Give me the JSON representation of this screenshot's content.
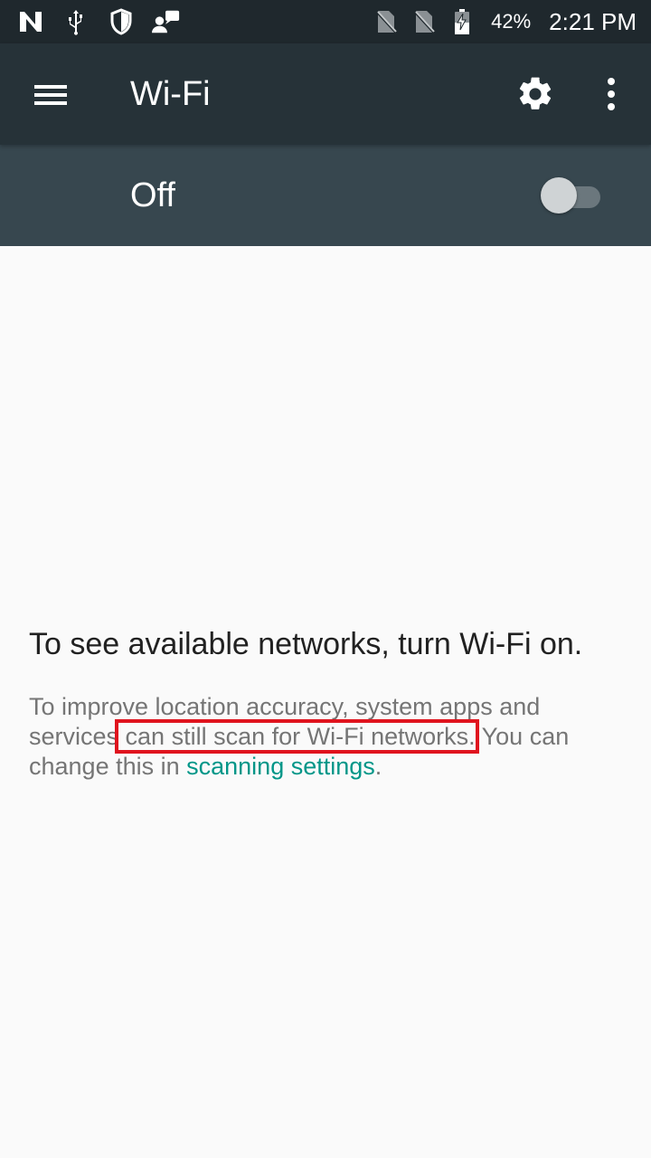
{
  "status_bar": {
    "icons": [
      "n-logo-icon",
      "usb-icon",
      "vpn-shield-icon",
      "person-message-icon",
      "no-sim-icon",
      "no-sim-icon",
      "battery-charging-icon"
    ],
    "battery_percent": "42%",
    "time": "2:21 PM"
  },
  "app_bar": {
    "title": "Wi-Fi",
    "menu_icon": "menu-icon",
    "settings_icon": "gear-icon",
    "overflow_icon": "more-vert-icon"
  },
  "switch_bar": {
    "label": "Off",
    "checked": false
  },
  "empty_state": {
    "title": "To see available networks, turn Wi-Fi on.",
    "body_part1": "To improve location accuracy, system apps and services",
    "body_highlight": " can still scan for Wi-Fi networks.",
    "body_part2": " You can change this in ",
    "link": "scanning settings",
    "body_end": "."
  },
  "colors": {
    "status_bar": "#1f282d",
    "app_bar": "#263238",
    "switch_bar": "#37474f",
    "link": "#009688",
    "highlight_box": "#e0141e"
  }
}
